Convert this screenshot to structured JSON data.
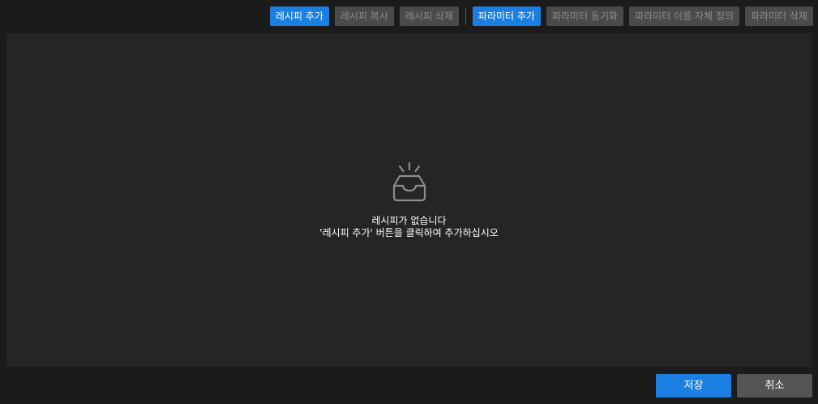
{
  "toolbar": {
    "add_recipe": "레시피 추가",
    "copy_recipe": "레시피 복사",
    "delete_recipe": "레시피 삭제",
    "add_parameter": "파라미터 추가",
    "sync_parameter": "파라미터 동기화",
    "custom_param_name": "파라미터 이름 자체 정의",
    "delete_parameter": "파라미터 삭제"
  },
  "empty_state": {
    "icon": "empty-inbox-icon",
    "line1": "레시피가 없습니다",
    "line2": "'레시피 추가' 버튼을 클릭하여 추가하십시오"
  },
  "footer": {
    "save": "저장",
    "cancel": "취소"
  },
  "colors": {
    "background": "#1b1b1b",
    "panel": "#252525",
    "primary": "#1a7fe0",
    "disabled": "#4a4a4a",
    "cancel": "#555555"
  }
}
